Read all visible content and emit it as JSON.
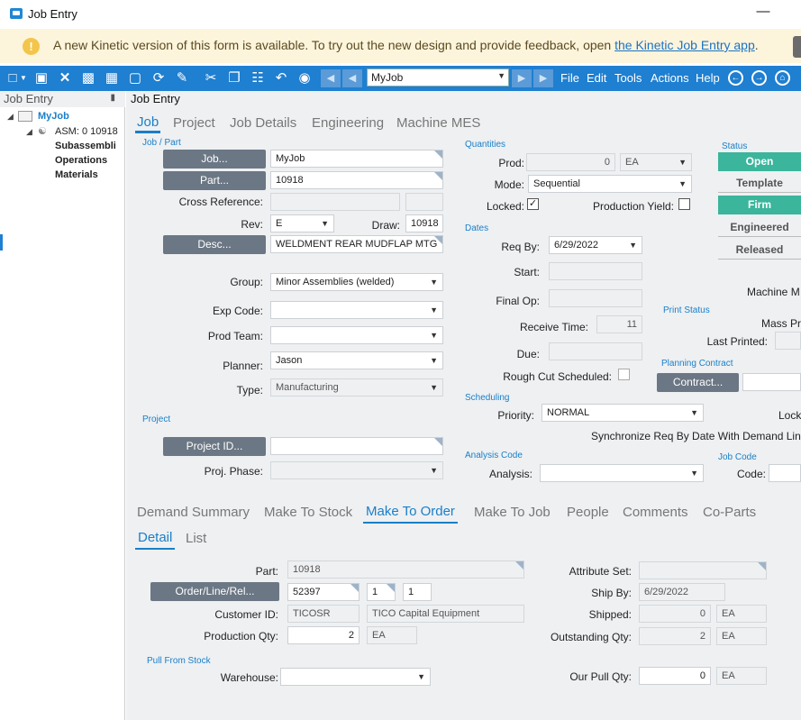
{
  "window": {
    "title": "Job Entry",
    "minimize": "—"
  },
  "banner": {
    "icon": "!",
    "text": "A new Kinetic version of this form is available. To try out the new design and provide feedback, open ",
    "link": "the Kinetic Job Entry app",
    "tail": "."
  },
  "toolbar": {
    "icons": [
      "new-icon",
      "save-icon",
      "delete-icon",
      "attach-icon",
      "grid-icon",
      "clear-icon",
      "refresh-icon",
      "clean-icon",
      "cut-icon",
      "copy-icon",
      "paste-icon",
      "undo-icon",
      "binoculars-icon"
    ],
    "job_value": "MyJob",
    "menus": [
      "File",
      "Edit",
      "Tools",
      "Actions",
      "Help"
    ]
  },
  "tree": {
    "header": "Job Entry",
    "root": "MyJob",
    "asm": "ASM: 0 10918",
    "children": [
      "Subassembli",
      "Operations",
      "Materials"
    ]
  },
  "main": {
    "header": "Job Entry",
    "tabs": [
      "Job",
      "Project",
      "Job Details",
      "Engineering",
      "Machine MES"
    ],
    "job_part": {
      "section": "Job / Part",
      "job_btn": "Job...",
      "job_value": "MyJob",
      "part_btn": "Part...",
      "part_value": "10918",
      "cross_ref_label": "Cross Reference:",
      "rev_label": "Rev:",
      "rev_value": "E",
      "draw_label": "Draw:",
      "draw_value": "10918",
      "desc_btn": "Desc...",
      "desc_value": "WELDMENT REAR MUDFLAP MTG",
      "group_label": "Group:",
      "group_value": "Minor Assemblies (welded)",
      "expcode_label": "Exp Code:",
      "expcode_value": "",
      "prodteam_label": "Prod Team:",
      "prodteam_value": "",
      "planner_label": "Planner:",
      "planner_value": "Jason",
      "type_label": "Type:",
      "type_value": "Manufacturing"
    },
    "project": {
      "section": "Project",
      "projectid_btn": "Project ID...",
      "projectid_value": "",
      "phase_label": "Proj. Phase:",
      "phase_value": ""
    },
    "quantities": {
      "section": "Quantities",
      "prod_label": "Prod:",
      "prod_value": "0",
      "prod_uom": "EA",
      "mode_label": "Mode:",
      "mode_value": "Sequential",
      "locked_label": "Locked:",
      "locked_check": "✓",
      "yield_label": "Production Yield:"
    },
    "dates": {
      "section": "Dates",
      "reqby_label": "Req By:",
      "reqby_value": "6/29/2022",
      "start_label": "Start:",
      "finalop_label": "Final Op:",
      "receive_label": "Receive Time:",
      "receive_value": "11",
      "due_label": "Due:",
      "roughcut_label": "Rough Cut Scheduled:"
    },
    "scheduling": {
      "section": "Scheduling",
      "priority_label": "Priority:",
      "priority_value": "NORMAL",
      "sync_label": "Synchronize Req By Date With Demand Lin"
    },
    "analysis": {
      "section": "Analysis Code",
      "analysis_label": "Analysis:"
    },
    "status": {
      "section": "Status",
      "buttons": [
        {
          "label": "Open",
          "active": true
        },
        {
          "label": "Template",
          "active": false
        },
        {
          "label": "Firm",
          "active": true
        },
        {
          "label": "Engineered",
          "active": false
        },
        {
          "label": "Released",
          "active": false
        }
      ],
      "machine_label": "Machine M",
      "active_color": "#3bb59b"
    },
    "print_status": {
      "section": "Print Status",
      "mass_label": "Mass Pr",
      "last_printed_label": "Last Printed:"
    },
    "planning": {
      "section": "Planning Contract",
      "contract_btn": "Contract..."
    },
    "lock_label": "Lock",
    "jobcode": {
      "section": "Job Code",
      "code_label": "Code:"
    }
  },
  "demand": {
    "tabs": [
      "Demand Summary",
      "Make To Stock",
      "Make To Order",
      "Make To Job",
      "People",
      "Comments",
      "Co-Parts"
    ],
    "subtabs": [
      "Detail",
      "List"
    ],
    "part_label": "Part:",
    "part_value": "10918",
    "order_btn": "Order/Line/Rel...",
    "order_value": "52397",
    "line_value": "1",
    "rel_value": "1",
    "customer_label": "Customer ID:",
    "customer_value": "TICOSR",
    "customer_name": "TICO Capital Equipment",
    "prodqty_label": "Production Qty:",
    "prodqty_value": "2",
    "prodqty_uom": "EA",
    "pull_section": "Pull From Stock",
    "warehouse_label": "Warehouse:",
    "attrset_label": "Attribute Set:",
    "shipby_label": "Ship By:",
    "shipby_value": "6/29/2022",
    "shipped_label": "Shipped:",
    "shipped_value": "0",
    "shipped_uom": "EA",
    "outstanding_label": "Outstanding Qty:",
    "outstanding_value": "2",
    "outstanding_uom": "EA",
    "ourpull_label": "Our Pull Qty:",
    "ourpull_value": "0",
    "ourpull_uom": "EA"
  }
}
